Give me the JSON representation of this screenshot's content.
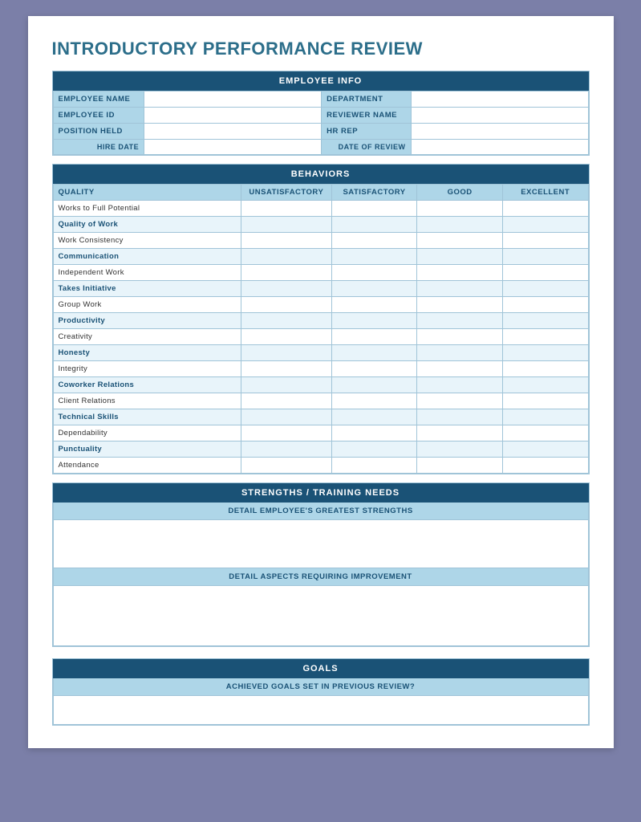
{
  "title": "INTRODUCTORY PERFORMANCE REVIEW",
  "employee_info": {
    "section_label": "EMPLOYEE INFO",
    "fields": [
      {
        "label": "EMPLOYEE NAME",
        "value": ""
      },
      {
        "label": "DEPARTMENT",
        "value": ""
      },
      {
        "label": "EMPLOYEE ID",
        "value": ""
      },
      {
        "label": "REVIEWER NAME",
        "value": ""
      },
      {
        "label": "POSITION HELD",
        "value": ""
      },
      {
        "label": "HR REP",
        "value": ""
      }
    ],
    "hire_date_label": "HIRE DATE",
    "hire_date_value": "",
    "date_of_review_label": "DATE OF REVIEW",
    "date_of_review_value": ""
  },
  "behaviors": {
    "section_label": "BEHAVIORS",
    "columns": [
      "QUALITY",
      "UNSATISFACTORY",
      "SATISFACTORY",
      "GOOD",
      "EXCELLENT"
    ],
    "rows": [
      {
        "label": "Works to Full Potential",
        "alt": false
      },
      {
        "label": "Quality of Work",
        "alt": true
      },
      {
        "label": "Work Consistency",
        "alt": false
      },
      {
        "label": "Communication",
        "alt": true
      },
      {
        "label": "Independent Work",
        "alt": false
      },
      {
        "label": "Takes Initiative",
        "alt": true
      },
      {
        "label": "Group Work",
        "alt": false
      },
      {
        "label": "Productivity",
        "alt": true
      },
      {
        "label": "Creativity",
        "alt": false
      },
      {
        "label": "Honesty",
        "alt": true
      },
      {
        "label": "Integrity",
        "alt": false
      },
      {
        "label": "Coworker Relations",
        "alt": true
      },
      {
        "label": "Client Relations",
        "alt": false
      },
      {
        "label": "Technical Skills",
        "alt": true
      },
      {
        "label": "Dependability",
        "alt": false
      },
      {
        "label": "Punctuality",
        "alt": true
      },
      {
        "label": "Attendance",
        "alt": false
      }
    ]
  },
  "strengths": {
    "section_label": "STRENGTHS / TRAINING NEEDS",
    "strengths_label": "DETAIL EMPLOYEE'S GREATEST STRENGTHS",
    "improvement_label": "DETAIL ASPECTS REQUIRING IMPROVEMENT"
  },
  "goals": {
    "section_label": "GOALS",
    "achieved_label": "ACHIEVED GOALS SET IN PREVIOUS REVIEW?"
  }
}
